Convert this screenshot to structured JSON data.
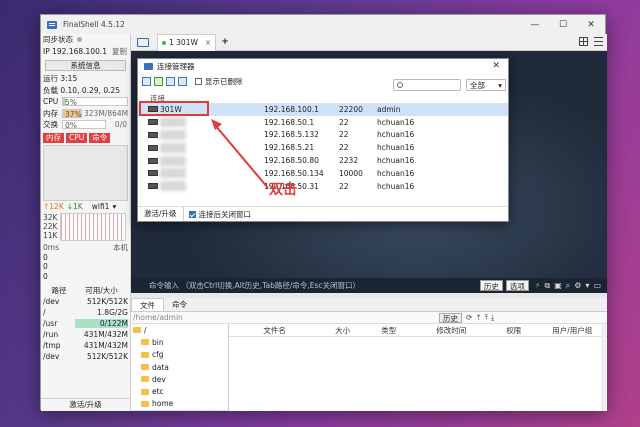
{
  "app": {
    "title": "FinalShell 4.5.12"
  },
  "left": {
    "sync_label": "同步状态",
    "ip_label": "IP",
    "ip_value": "192.168.100.1",
    "copy_label": "复制",
    "sysinfo_label": "系统信息",
    "uptime": "运行 3:15",
    "load": "负载 0.10, 0.29, 0.25",
    "cpu_label": "CPU",
    "cpu_value": "5%",
    "cpu_fraction": 0.05,
    "mem_label": "内存",
    "mem_percent": "37%",
    "mem_value": "323M/864M",
    "mem_fraction": 0.37,
    "swap_label": "交换",
    "swap_percent": "0%",
    "swap_value": "0/0",
    "proc_tabs": [
      "内存",
      "CPU",
      "命令"
    ],
    "net_up": "↑12K",
    "net_down": "↓1K",
    "net_iface": "wifi1",
    "net_axis": [
      "32K",
      "22K",
      "11K"
    ],
    "ping_label": "0ms",
    "ping_host": "本机",
    "ping_values": [
      "0",
      "0",
      "0"
    ],
    "disk_head": [
      "路径",
      "可用/大小"
    ],
    "disks": [
      {
        "path": "/dev",
        "size": "512K/512K"
      },
      {
        "path": "/",
        "size": "1.8G/2G"
      },
      {
        "path": "/usr",
        "size": "0/122M"
      },
      {
        "path": "/run",
        "size": "431M/432M"
      },
      {
        "path": "/tmp",
        "size": "431M/432M"
      },
      {
        "path": "/dev",
        "size": "512K/512K"
      }
    ],
    "bottom": "激活/升级"
  },
  "tabbar": {
    "tab_label": "1 301W",
    "close": "×",
    "add": "+"
  },
  "dialog": {
    "title": "连接管理器",
    "show_deleted": "显示已删除",
    "filter_value": "全部",
    "group": "连接",
    "servers": [
      {
        "name": "301W",
        "host": "192.168.100.1",
        "port": "22200",
        "user": "admin"
      },
      {
        "name": "",
        "host": "192.168.50.1",
        "port": "22",
        "user": "hchuan16"
      },
      {
        "name": "",
        "host": "192.168.5.132",
        "port": "22",
        "user": "hchuan16"
      },
      {
        "name": "",
        "host": "192.168.5.21",
        "port": "22",
        "user": "hchuan16"
      },
      {
        "name": "",
        "host": "192.168.50.80",
        "port": "2232",
        "user": "hchuan16"
      },
      {
        "name": "",
        "host": "192.168.50.134",
        "port": "10000",
        "user": "hchuan16"
      },
      {
        "name": "",
        "host": "192.168.50.31",
        "port": "22",
        "user": "hchuan16"
      }
    ],
    "activate": "激活/升级",
    "close_after": "连接后关闭窗口"
  },
  "annotation": "双击",
  "cmdbar": {
    "hint": "命令输入 （双击Ctrl切换,Alt历史,Tab路径/命令,Esc关闭窗口）",
    "history": "历史",
    "options": "选项"
  },
  "files": {
    "tabs": [
      "文件",
      "命令"
    ],
    "path": "/home/admin",
    "history": "历史",
    "tree": [
      "/",
      "bin",
      "cfg",
      "data",
      "dev",
      "etc",
      "home",
      "admin",
      "ini"
    ],
    "columns": [
      "文件名",
      "大小",
      "类型",
      "修改时间",
      "权限",
      "用户/用户组"
    ]
  }
}
